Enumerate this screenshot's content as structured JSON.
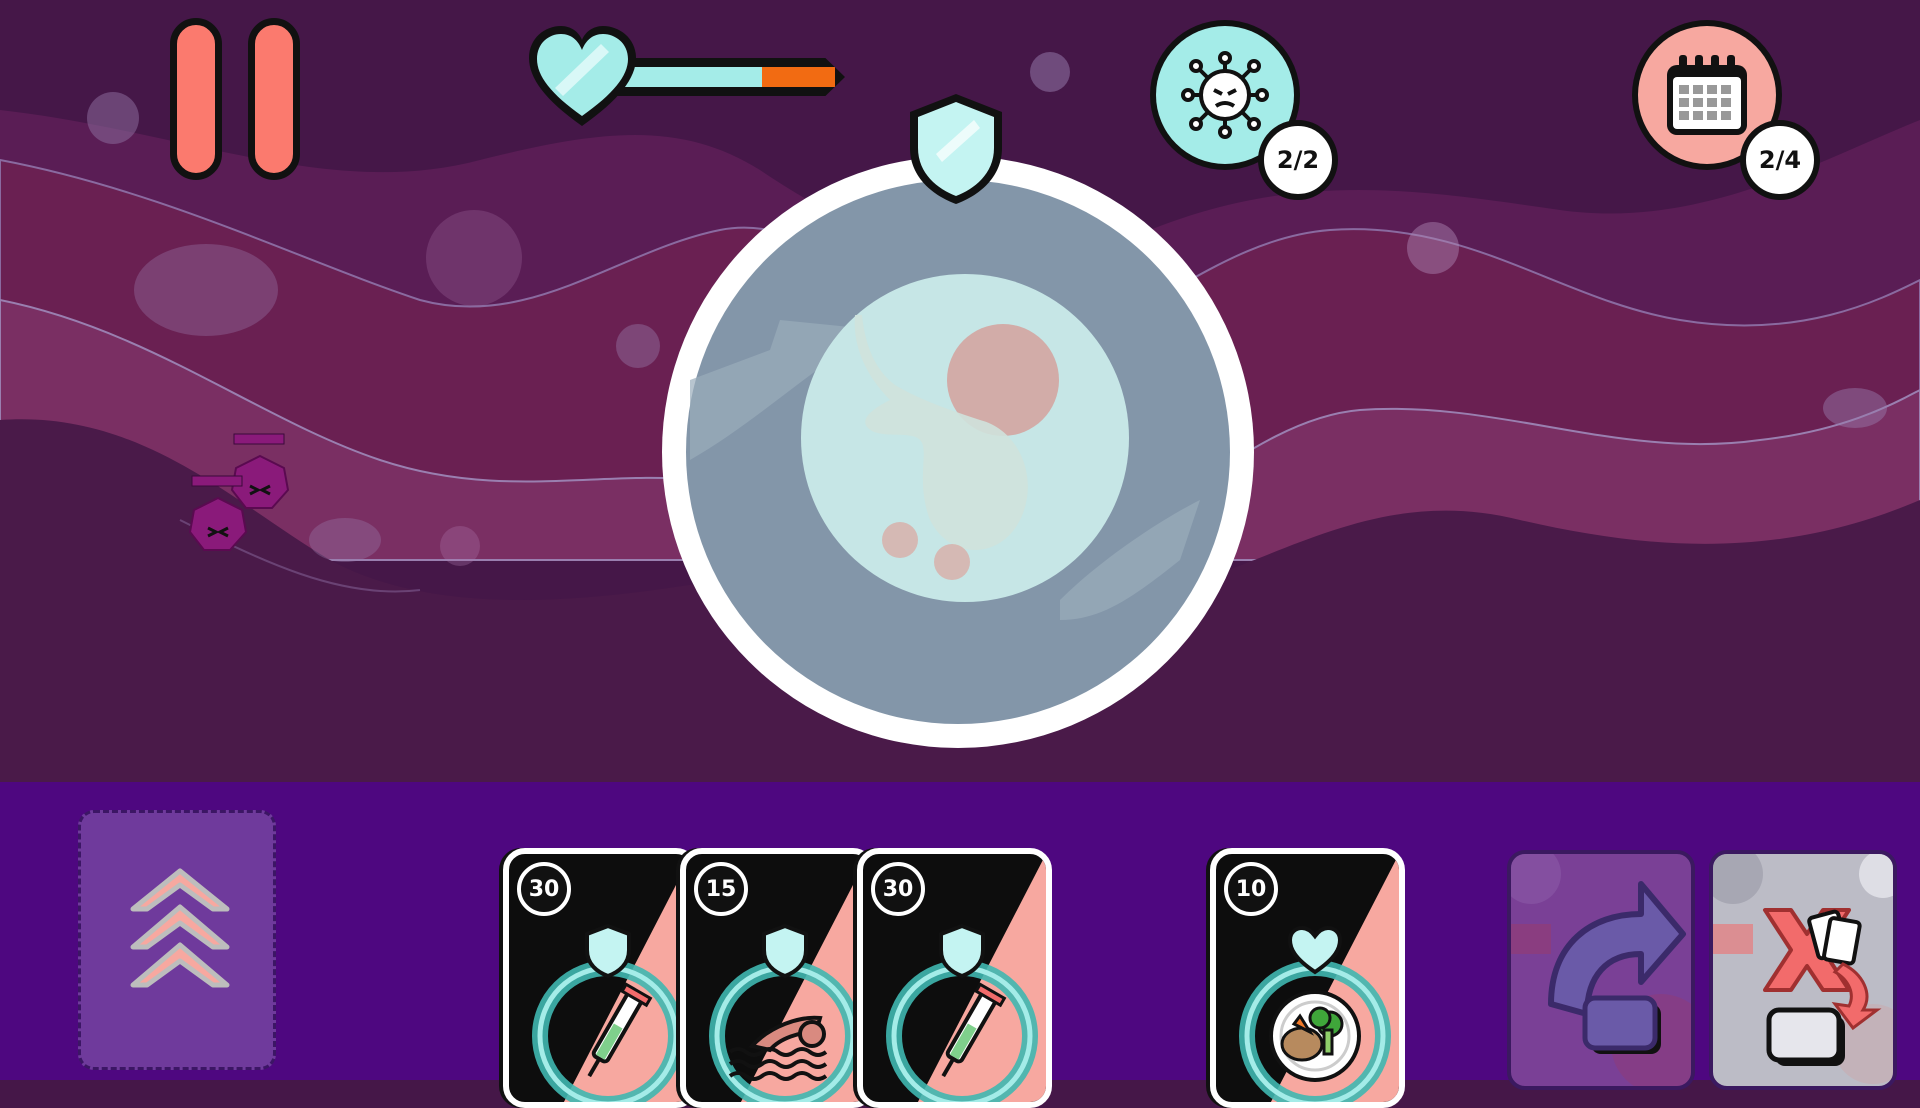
{
  "hud": {
    "health": {
      "fraction": 0.66,
      "accent": "#a4ece8",
      "damage_color": "#f26b12"
    },
    "virus_counter": {
      "icon": "virus-icon",
      "text": "2/2",
      "color": "#a4ece8"
    },
    "day_counter": {
      "icon": "calendar-icon",
      "text": "2/4",
      "color": "#f7a8a0"
    },
    "shield": {
      "icon": "shield-icon"
    },
    "pause": {
      "icon": "pause-icon"
    }
  },
  "hand": {
    "deck_button": {
      "icon": "chevron-up-stack-icon"
    },
    "cards": [
      {
        "cost": "30",
        "type": "shield",
        "art": "syringe-icon"
      },
      {
        "cost": "15",
        "type": "shield",
        "art": "swimming-icon"
      },
      {
        "cost": "30",
        "type": "shield",
        "art": "syringe-icon"
      },
      {
        "cost": "10",
        "type": "heal",
        "art": "healthy-food-icon"
      }
    ],
    "redraw_button": {
      "icon": "redraw-arrow-icon"
    },
    "discard_button": {
      "icon": "discard-cards-icon"
    }
  },
  "colors": {
    "accent_mint": "#a4ece8",
    "accent_salmon": "#fb7a6e",
    "tray": "#4e0780"
  }
}
